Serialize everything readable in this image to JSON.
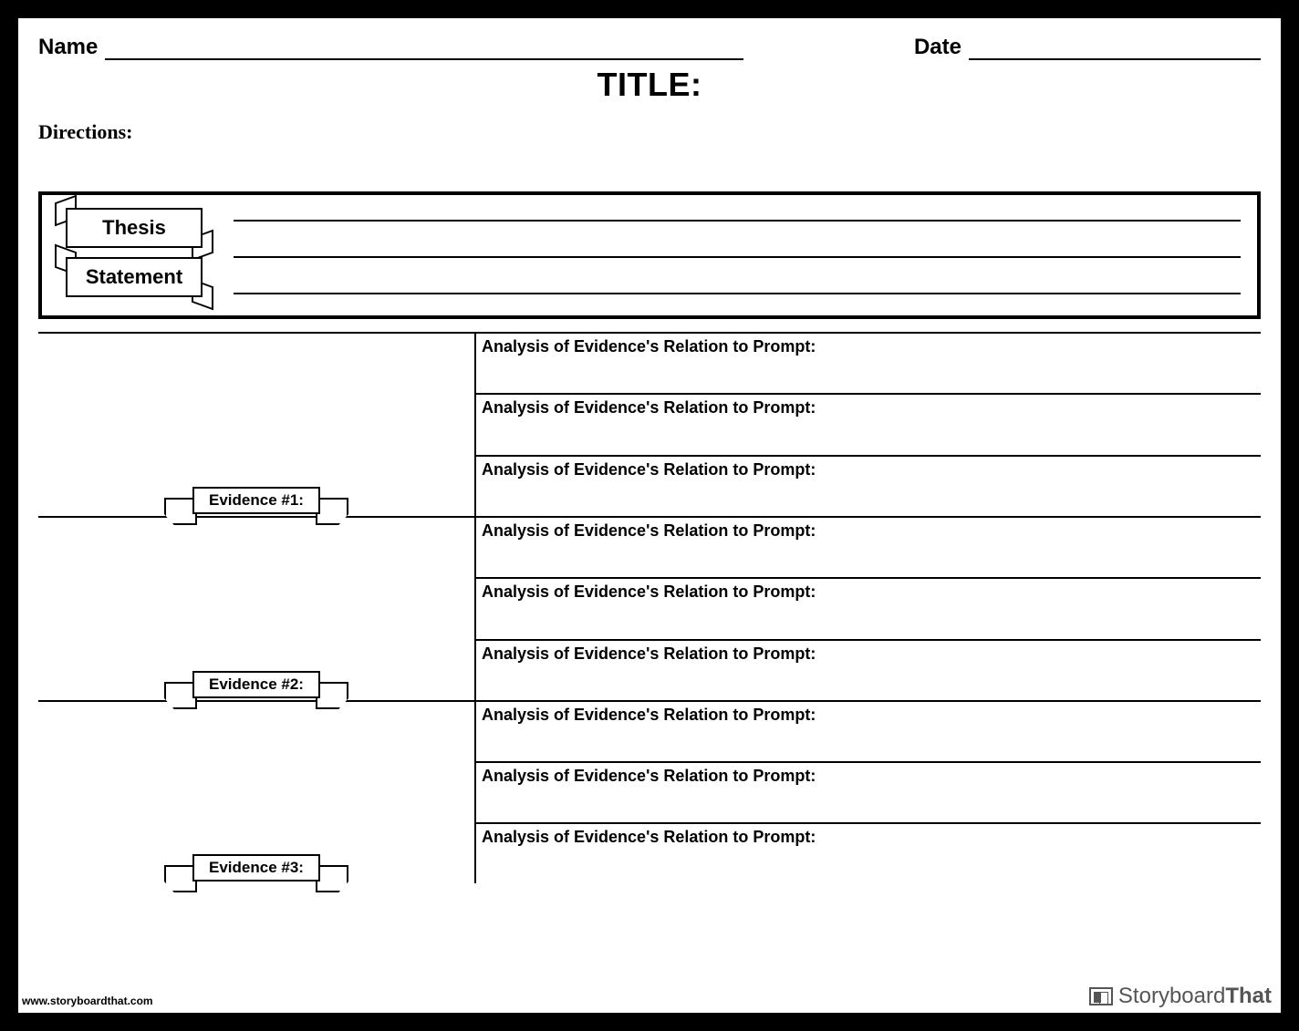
{
  "header": {
    "name_label": "Name",
    "date_label": "Date",
    "title": "TITLE:"
  },
  "directions_label": "Directions:",
  "thesis": {
    "line1": "Thesis",
    "line2": "Statement"
  },
  "evidence_rows": [
    {
      "label": "Evidence #1:",
      "analysis_label": "Analysis of Evidence's Relation to Prompt:"
    },
    {
      "label": "Evidence #2:",
      "analysis_label": "Analysis of Evidence's Relation to Prompt:"
    },
    {
      "label": "Evidence #3:",
      "analysis_label": "Analysis of Evidence's Relation to Prompt:"
    }
  ],
  "footer": {
    "url": "www.storyboardthat.com",
    "brand_a": "Storyboard",
    "brand_b": "That"
  }
}
